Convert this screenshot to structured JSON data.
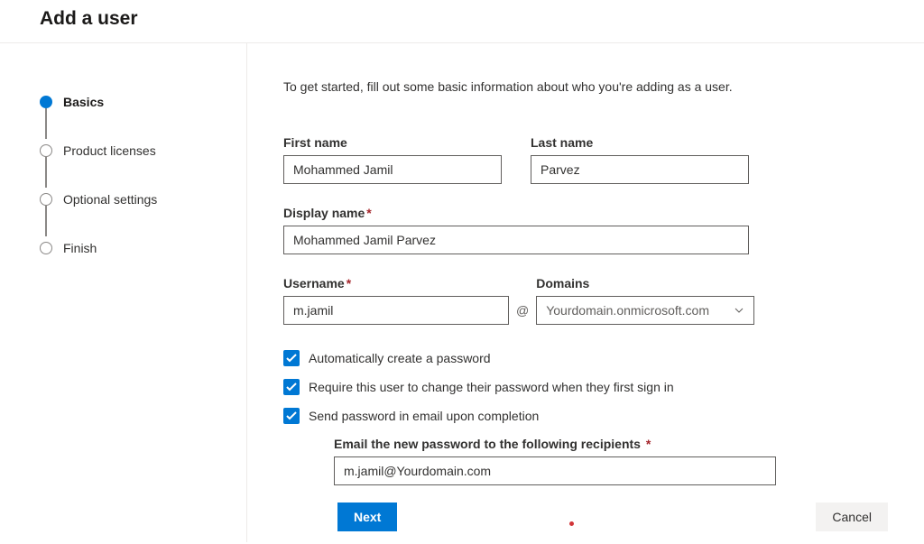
{
  "header": {
    "title": "Add a user"
  },
  "steps": [
    {
      "label": "Basics",
      "active": true
    },
    {
      "label": "Product licenses",
      "active": false
    },
    {
      "label": "Optional settings",
      "active": false
    },
    {
      "label": "Finish",
      "active": false
    }
  ],
  "intro": "To get started, fill out some basic information about who you're adding as a user.",
  "labels": {
    "first_name": "First name",
    "last_name": "Last name",
    "display_name": "Display name",
    "username": "Username",
    "domains": "Domains",
    "auto_password": "Automatically create a password",
    "require_change": "Require this user to change their password when they first sign in",
    "send_email": "Send password in email upon completion",
    "email_recipients": "Email the new password to the following recipients"
  },
  "values": {
    "first_name": "Mohammed Jamil",
    "last_name": "Parvez",
    "display_name": "Mohammed Jamil Parvez",
    "username": "m.jamil",
    "at": "@",
    "domain": "Yourdomain.onmicrosoft.com",
    "email_recipients": "m.jamil@Yourdomain.com"
  },
  "footer": {
    "next": "Next",
    "cancel": "Cancel"
  }
}
